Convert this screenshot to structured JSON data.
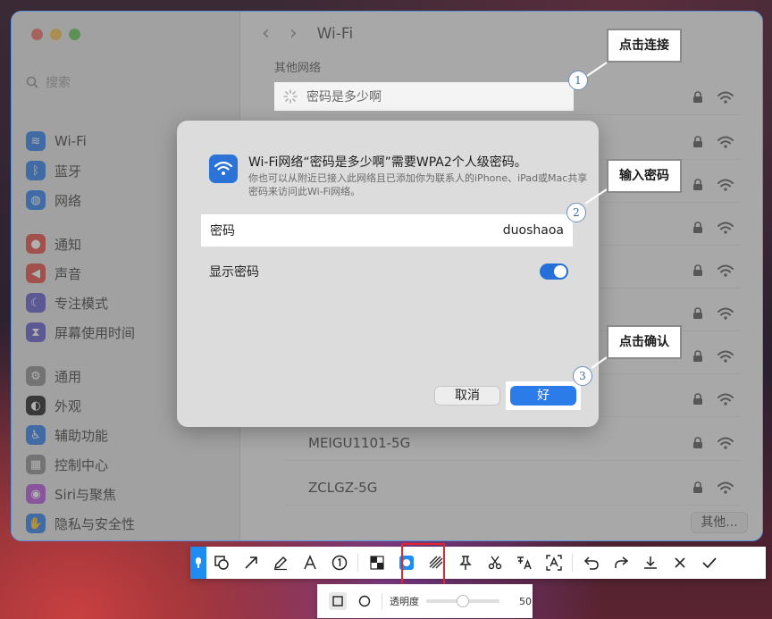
{
  "window": {
    "traffic_colors": [
      "#ec6a5e",
      "#f4bf4f",
      "#61c554"
    ],
    "search_placeholder": "搜索",
    "title": "Wi-Fi",
    "section_header": "其他网络",
    "sidebar": [
      {
        "label": "Wi-Fi",
        "icon": "wifi-icon",
        "color": "#2b7be8"
      },
      {
        "label": "蓝牙",
        "icon": "bluetooth-icon",
        "color": "#2b7be8"
      },
      {
        "label": "网络",
        "icon": "globe-icon",
        "color": "#2b7be8"
      },
      {
        "label": "通知",
        "icon": "bell-icon",
        "color": "#e2473f"
      },
      {
        "label": "声音",
        "icon": "speaker-icon",
        "color": "#e2473f"
      },
      {
        "label": "专注模式",
        "icon": "moon-icon",
        "color": "#5d56c8"
      },
      {
        "label": "屏幕使用时间",
        "icon": "hourglass-icon",
        "color": "#5d56c8"
      },
      {
        "label": "通用",
        "icon": "gear-icon",
        "color": "#8a8a8a"
      },
      {
        "label": "外观",
        "icon": "appearance-icon",
        "color": "#1c1c1c"
      },
      {
        "label": "辅助功能",
        "icon": "accessibility-icon",
        "color": "#2b7be8"
      },
      {
        "label": "控制中心",
        "icon": "control-center-icon",
        "color": "#8a8a8a"
      },
      {
        "label": "Siri与聚焦",
        "icon": "siri-icon",
        "color": "#b24fd8"
      },
      {
        "label": "隐私与安全性",
        "icon": "hand-icon",
        "color": "#2b7be8"
      }
    ],
    "networks": [
      {
        "name": "密码是多少啊"
      },
      {
        "name": ""
      },
      {
        "name": ""
      },
      {
        "name": ""
      },
      {
        "name": ""
      },
      {
        "name": ""
      },
      {
        "name": ""
      },
      {
        "name": ""
      },
      {
        "name": "MEIGU1101-5G"
      },
      {
        "name": "ZCLGZ-5G"
      }
    ],
    "other_button": "其他..."
  },
  "dialog": {
    "title": "Wi-Fi网络“密码是多少啊”需要WPA2个人级密码。",
    "subtitle": "你也可以从附近已接入此网络且已添加你为联系人的iPhone、iPad或Mac共享密码来访问此Wi-Fi网络。",
    "password_label": "密码",
    "password_value": "duoshaoa",
    "show_password_label": "显示密码",
    "show_password_on": true,
    "cancel_label": "取消",
    "ok_label": "好"
  },
  "callouts": [
    {
      "num": "1",
      "text": "点击连接"
    },
    {
      "num": "2",
      "text": "输入密码"
    },
    {
      "num": "3",
      "text": "点击确认"
    }
  ],
  "toolbar": {
    "tools": [
      "rectangle-tool-icon",
      "arrow-tool-icon",
      "pen-tool-icon",
      "text-tool-icon",
      "number-tool-icon",
      "mosaic-tool-icon",
      "highlight-tool-icon",
      "blur-tool-icon",
      "pin-tool-icon",
      "scissors-tool-icon",
      "translate-tool-icon",
      "ocr-tool-icon"
    ],
    "actions": [
      "undo-icon",
      "redo-icon",
      "download-icon",
      "close-icon",
      "confirm-icon"
    ],
    "accent": "#1e8cf0",
    "active_outline": "#e0282e"
  },
  "subbar": {
    "opacity_label": "透明度",
    "opacity_value": "50",
    "opacity": 0.5
  }
}
